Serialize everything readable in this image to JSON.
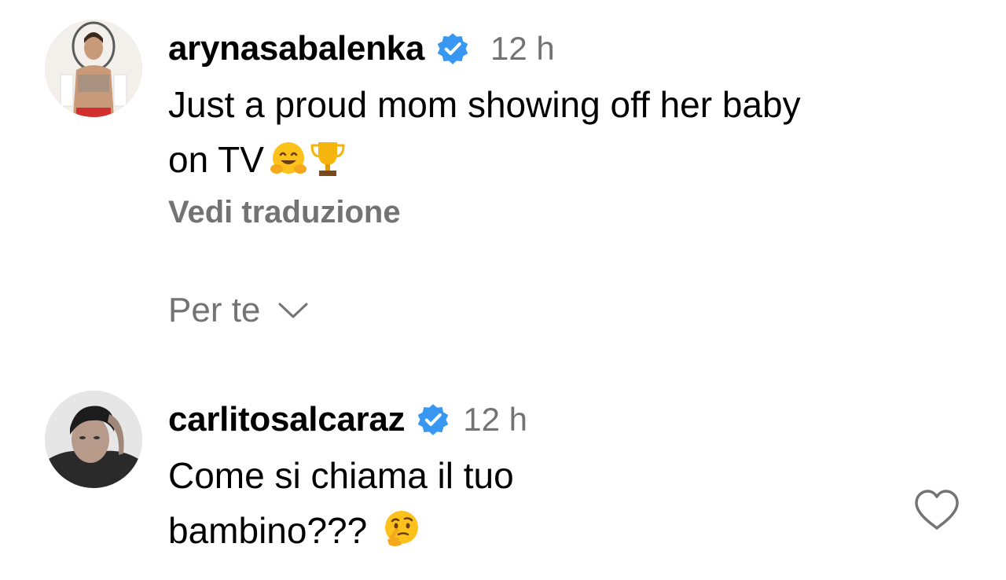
{
  "comments": [
    {
      "username": "arynasabalenka",
      "time": "12 h",
      "text": "Just a proud mom showing off her baby\non TV",
      "emojis": [
        "hugging-face",
        "trophy"
      ],
      "see_translation": "Vedi traduzione"
    },
    {
      "username": "carlitosalcaraz",
      "time": "12 h",
      "text": "Come si chiama il tuo\nbambino???",
      "emojis": [
        "thinking-face"
      ]
    }
  ],
  "filter": {
    "label": "Per te",
    "icon": "chevron-down-icon"
  },
  "icons": {
    "verified": "verified-badge-icon",
    "like": "heart-outline-icon"
  },
  "colors": {
    "verified_blue": "#3897f0",
    "secondary_text": "#737373",
    "text": "#000000"
  }
}
